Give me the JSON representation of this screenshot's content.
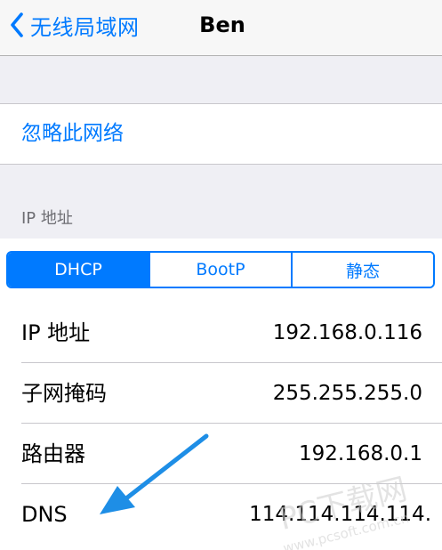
{
  "navbar": {
    "back_label": "无线局域网",
    "title": "Ben"
  },
  "actions": {
    "forget_network": "忽略此网络"
  },
  "ip_section": {
    "header": "IP 地址",
    "segments": [
      {
        "label": "DHCP",
        "selected": true
      },
      {
        "label": "BootP",
        "selected": false
      },
      {
        "label": "静态",
        "selected": false
      }
    ]
  },
  "info_rows": [
    {
      "label": "IP 地址",
      "value": "192.168.0.116"
    },
    {
      "label": "子网掩码",
      "value": "255.255.255.0"
    },
    {
      "label": "路由器",
      "value": "192.168.0.1"
    },
    {
      "label": "DNS",
      "value": "114.114.114.114."
    }
  ],
  "watermark": {
    "main": "PC下载网",
    "url": "www.pcsoft.com.cn"
  },
  "colors": {
    "accent": "#007aff",
    "background": "#efeff4",
    "cell": "#ffffff",
    "separator": "#c8c7cc",
    "header_text": "#6d6d72",
    "annotation_arrow": "#1e8ee6"
  },
  "icons": {
    "back": "chevron-left-icon",
    "annotation": "arrow-icon"
  }
}
